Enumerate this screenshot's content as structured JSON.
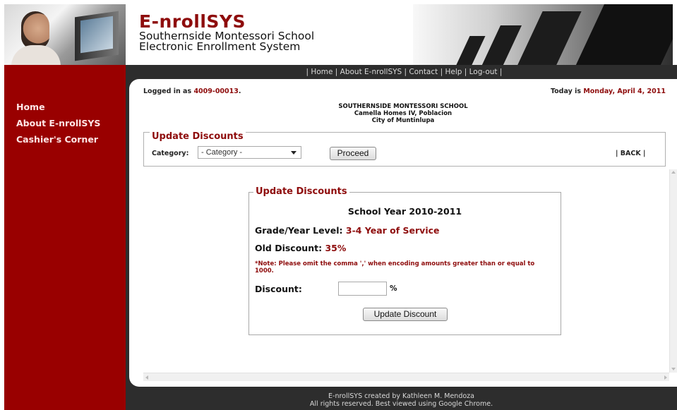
{
  "header": {
    "brand": "E-nrollSYS",
    "subtitle_line1": "Southernside Montessori School",
    "subtitle_line2": "Electronic Enrollment System"
  },
  "topnav": {
    "text": "| Home | About E-nrollSYS | Contact | Help | Log-out |"
  },
  "sidebar": {
    "items": [
      {
        "label": "Home"
      },
      {
        "label": "About E-nrollSYS"
      },
      {
        "label": "Cashier's Corner"
      }
    ]
  },
  "status": {
    "logged_prefix": "Logged in as ",
    "logged_user": "4009-00013",
    "logged_suffix": ".",
    "today_prefix": "Today is ",
    "today_date": "Monday, April 4, 2011"
  },
  "school": {
    "name": "SOUTHERNSIDE MONTESSORI SCHOOL",
    "address1": "Camella Homes IV, Poblacion",
    "address2": "City of Muntinlupa"
  },
  "filter": {
    "legend": "Update Discounts",
    "category_label": "Category:",
    "category_value": "- Category -",
    "proceed_label": "Proceed",
    "back_label": "| BACK |"
  },
  "form": {
    "legend": "Update Discounts",
    "school_year": "School Year 2010-2011",
    "grade_label": "Grade/Year Level: ",
    "grade_value": "3-4 Year of Service",
    "old_label": "Old Discount: ",
    "old_value": "35%",
    "note": "*Note: Please omit the comma ',' when encoding amounts greater than or equal to 1000.",
    "discount_label": "Discount:",
    "discount_value": "",
    "percent_sign": "%",
    "update_label": "Update Discount"
  },
  "footer": {
    "line1": "E-nrollSYS created by Kathleen M. Mendoza",
    "line2": "All rights reserved. Best viewed using Google Chrome."
  }
}
